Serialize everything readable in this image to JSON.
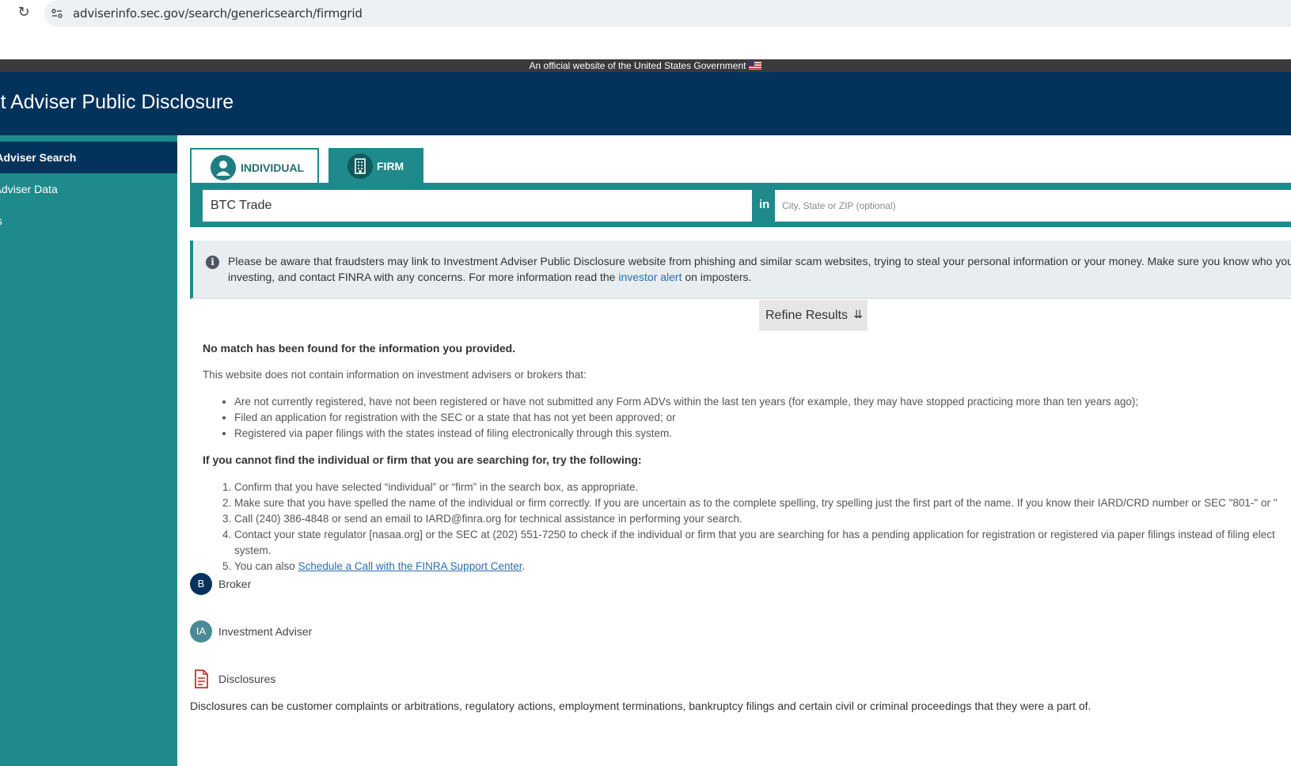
{
  "browser": {
    "url": "adviserinfo.sec.gov/search/genericsearch/firmgrid"
  },
  "gov_banner": "An official website of the United States Government",
  "header": {
    "title": "tment Adviser Public Disclosure"
  },
  "sidebar": {
    "items": [
      {
        "label": "ent Adviser Search",
        "active": true
      },
      {
        "label": "ent Adviser Data"
      },
      {
        "label": "es"
      }
    ]
  },
  "tabs": {
    "individual": "INDIVIDUAL",
    "firm": "FIRM"
  },
  "search": {
    "value": "BTC Trade",
    "in_label": "in",
    "location_placeholder": "City, State or ZIP (optional)"
  },
  "alert": {
    "line1": "Please be aware that fraudsters may link to Investment Adviser Public Disclosure website from phishing and similar scam websites, trying to steal your personal information or your money. Make sure you know who you're",
    "line2_pre": "investing, and contact FINRA with any concerns. For more information read the ",
    "link": "investor alert",
    "line2_post": " on imposters."
  },
  "refine": {
    "label": "Refine Results",
    "chevron": "»"
  },
  "results": {
    "no_match": "No match has been found for the information you provided.",
    "not_contain": "This website does not contain information on investment advisers or brokers that:",
    "bullets": [
      "Are not currently registered, have not been registered or have not submitted any Form ADVs within the last ten years (for example, they may have stopped practicing more than ten years ago);",
      "Filed an application for registration with the SEC or a state that has not yet been approved; or",
      "Registered via paper filings with the states instead of filing electronically through this system."
    ],
    "try_heading": "If you cannot find the individual or firm that you are searching for, try the following:",
    "steps": [
      "Confirm that you have selected “individual” or “firm” in the search box, as appropriate.",
      "Make sure that you have spelled the name of the individual or firm correctly. If you are uncertain as to the complete spelling, try spelling just the first part of the name. If you know their IARD/CRD number or SEC \"801-\" or \"",
      "Call (240) 386-4848 or send an email to IARD@finra.org for technical assistance in performing your search.",
      "Contact your state regulator [nasaa.org] or the SEC at (202) 551-7250 to check if the individual or firm that you are searching for has a pending application for registration or registered via paper filings instead of filing elect",
      "system."
    ],
    "step5_pre": "You can also ",
    "step5_link": "Schedule a Call with the FINRA Support Center",
    "step5_post": "."
  },
  "legend": {
    "broker_badge": "B",
    "broker": "Broker",
    "ia_badge": "IA",
    "ia": "Investment Adviser",
    "disclosures": "Disclosures",
    "disclosures_desc": "Disclosures can be customer complaints or arbitrations, regulatory actions, employment terminations, bankruptcy filings and certain civil or criminal proceedings that they were a part of."
  },
  "colors": {
    "header": "#03325a",
    "teal": "#1f8a8b",
    "link": "#2a6db0",
    "disclosure_icon": "#c0392b"
  },
  "icons": {
    "reload": "reload-icon",
    "site_info": "site-info-icon",
    "person": "person-icon",
    "building": "building-icon",
    "info": "info-icon",
    "chevron": "double-chevron-down-icon",
    "document": "document-icon"
  }
}
